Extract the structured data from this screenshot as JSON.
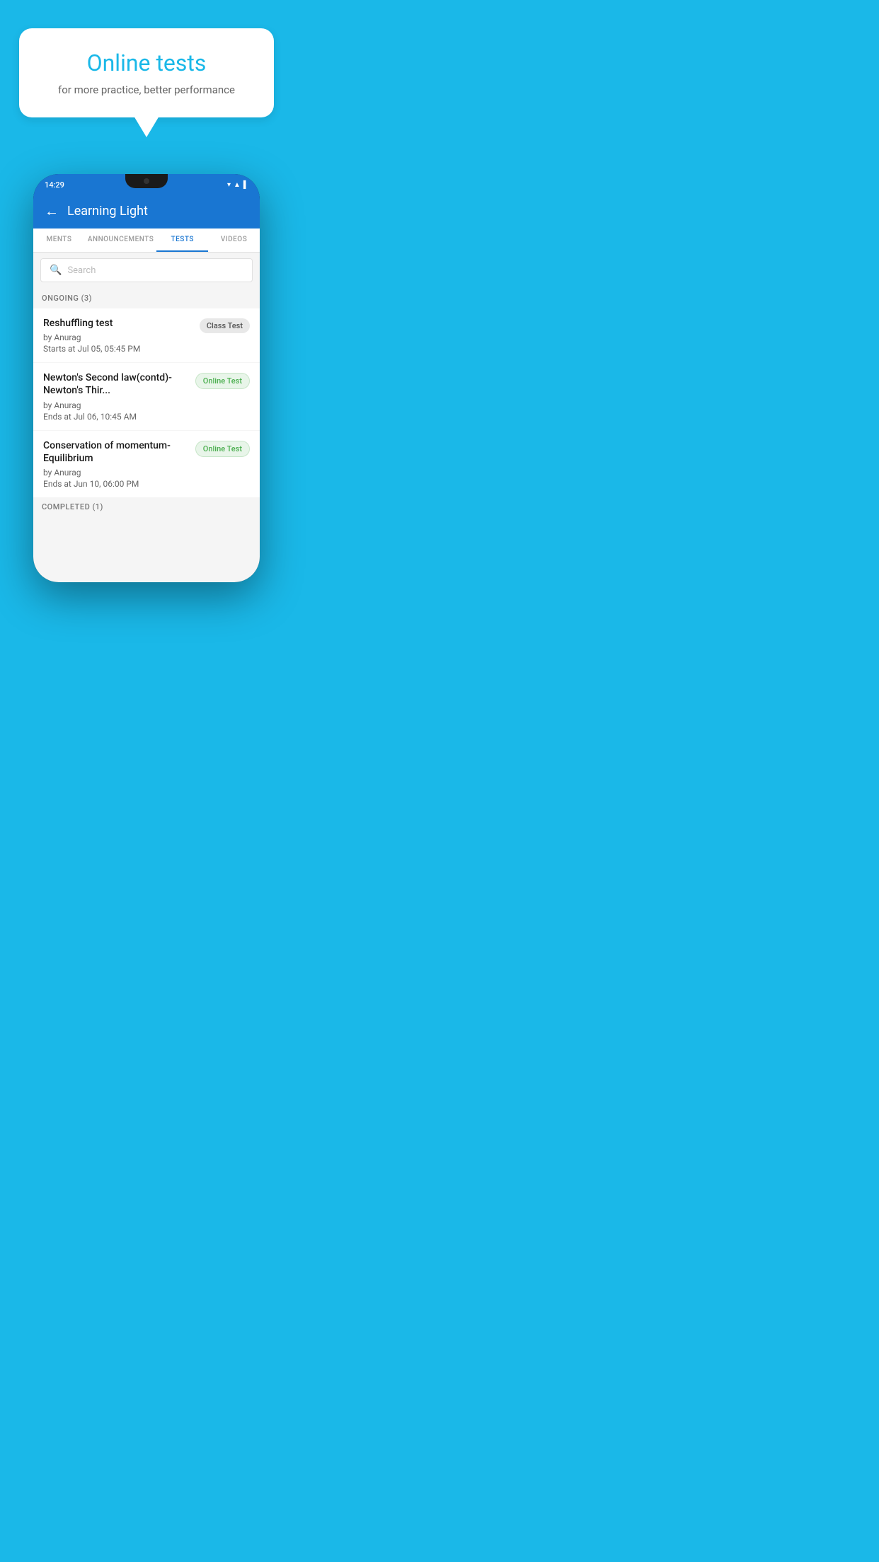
{
  "background_color": "#1ab8e8",
  "speech_bubble": {
    "title": "Online tests",
    "subtitle": "for more practice, better performance"
  },
  "phone": {
    "status_bar": {
      "time": "14:29",
      "icons": [
        "wifi",
        "signal",
        "battery"
      ]
    },
    "app_header": {
      "title": "Learning Light",
      "back_label": "←"
    },
    "tabs": [
      {
        "label": "MENTS",
        "active": false
      },
      {
        "label": "ANNOUNCEMENTS",
        "active": false
      },
      {
        "label": "TESTS",
        "active": true
      },
      {
        "label": "VIDEOS",
        "active": false
      }
    ],
    "search": {
      "placeholder": "Search"
    },
    "sections": [
      {
        "header": "ONGOING (3)",
        "items": [
          {
            "name": "Reshuffling test",
            "by": "by Anurag",
            "date": "Starts at  Jul 05, 05:45 PM",
            "badge": "Class Test",
            "badge_type": "class"
          },
          {
            "name": "Newton's Second law(contd)-Newton's Thir...",
            "by": "by Anurag",
            "date": "Ends at  Jul 06, 10:45 AM",
            "badge": "Online Test",
            "badge_type": "online"
          },
          {
            "name": "Conservation of momentum-Equilibrium",
            "by": "by Anurag",
            "date": "Ends at  Jun 10, 06:00 PM",
            "badge": "Online Test",
            "badge_type": "online"
          }
        ]
      }
    ],
    "completed_section_header": "COMPLETED (1)"
  }
}
